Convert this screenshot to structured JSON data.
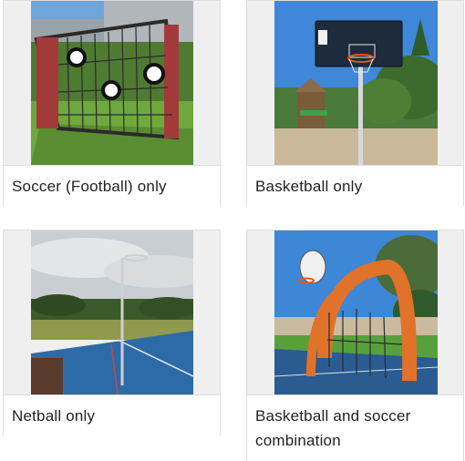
{
  "cards": [
    {
      "caption": "Soccer (Football) only",
      "image": "soccer-goal-photo"
    },
    {
      "caption": "Basketball only",
      "image": "basketball-hoop-photo"
    },
    {
      "caption": "Netball only",
      "image": "netball-hoop-photo"
    },
    {
      "caption": "Basketball and soccer combination",
      "image": "combo-goal-photo"
    }
  ],
  "colors": {
    "card_bg": "#efefef",
    "caption_text": "#222222",
    "sky": "#4a8fd6",
    "grass": "#5f9a3a",
    "court_blue": "#2b6fa8"
  }
}
